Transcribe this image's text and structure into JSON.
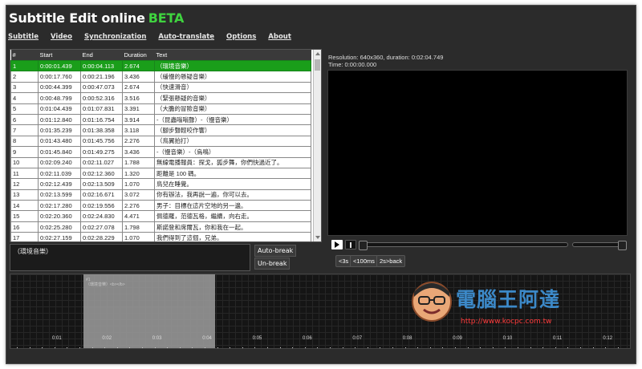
{
  "app": {
    "title": "Subtitle Edit online",
    "badge": "BETA"
  },
  "menu": [
    "Subtitle",
    "Video",
    "Synchronization",
    "Auto-translate",
    "Options",
    "About"
  ],
  "grid": {
    "columns": [
      "#",
      "Start",
      "End",
      "Duration",
      "Text"
    ],
    "rows": [
      [
        "1",
        "0:00:01.439",
        "0:00:04.113",
        "2.674",
        "（環境音樂）"
      ],
      [
        "2",
        "0:00:17.760",
        "0:00:21.196",
        "3.436",
        "（緩慢的懸疑音樂）"
      ],
      [
        "3",
        "0:00:44.399",
        "0:00:47.073",
        "2.674",
        "（快速滑音）"
      ],
      [
        "4",
        "0:00:48.799",
        "0:00:52.316",
        "3.516",
        "（緊張懸疑的音樂）"
      ],
      [
        "5",
        "0:01:04.439",
        "0:01:07.831",
        "3.391",
        "（大膽的冒險音樂）"
      ],
      [
        "6",
        "0:01:12.840",
        "0:01:16.754",
        "3.914",
        "-（昆蟲嗡嗡聲）-（慢音樂）"
      ],
      [
        "7",
        "0:01:35.239",
        "0:01:38.358",
        "3.118",
        "（腳步聲輕咬作響）"
      ],
      [
        "8",
        "0:01:43.480",
        "0:01:45.756",
        "2.276",
        "（鳥翼拍打）"
      ],
      [
        "9",
        "0:01:45.840",
        "0:01:49.275",
        "3.436",
        "-（慢音樂）-（烏鳴）"
      ],
      [
        "10",
        "0:02:09.240",
        "0:02:11.027",
        "1.788",
        "無線電播報員：探戈，狐步舞，你們快過近了。"
      ],
      [
        "11",
        "0:02:11.039",
        "0:02:12.360",
        "1.320",
        "距離是 100 碼。"
      ],
      [
        "12",
        "0:02:12.439",
        "0:02:13.509",
        "1.070",
        "鳥兒在睡覺。"
      ],
      [
        "13",
        "0:02:13.599",
        "0:02:16.671",
        "3.072",
        "你有辦法，我再說一遍，你可以去。"
      ],
      [
        "14",
        "0:02:17.280",
        "0:02:19.556",
        "2.276",
        "男子：目標在這片空地的另一邊。"
      ],
      [
        "15",
        "0:02:20.360",
        "0:02:24.830",
        "4.471",
        "佩德羅，范德瓦格，繼續，向右走。"
      ],
      [
        "16",
        "0:02:25.280",
        "0:02:27.078",
        "1.798",
        "斯諾登和席爾瓦，你和我在一起。"
      ],
      [
        "17",
        "0:02:27.159",
        "0:02:28.229",
        "1.070",
        "我們得到了這個，兄弟。"
      ],
      [
        "18",
        "0:02:28.879",
        "0:02:30.234",
        "1.354",
        "我們得是得到這個。"
      ]
    ]
  },
  "editor": {
    "text": "（環境音樂）",
    "auto_break": "Auto-break",
    "un_break": "Un-break"
  },
  "video": {
    "info_line1": "Resolution: 640x360, duration: 0:02:04.749",
    "info_line2": "Time: 0:00:00.000",
    "nav": [
      "<3s",
      "<100ms",
      "2s>back"
    ]
  },
  "waveform": {
    "selection_label_1": "#1",
    "selection_label_2": "（環境音樂）<b></b>",
    "ticks": [
      "0:01",
      "0:02",
      "0:03",
      "0:04",
      "0:05",
      "0:06",
      "0:07",
      "0:08",
      "0:09",
      "0:10",
      "0:11",
      "0:12"
    ]
  },
  "watermark": {
    "text": "電腦王阿達",
    "url": "http://www.kocpc.com.tw"
  }
}
